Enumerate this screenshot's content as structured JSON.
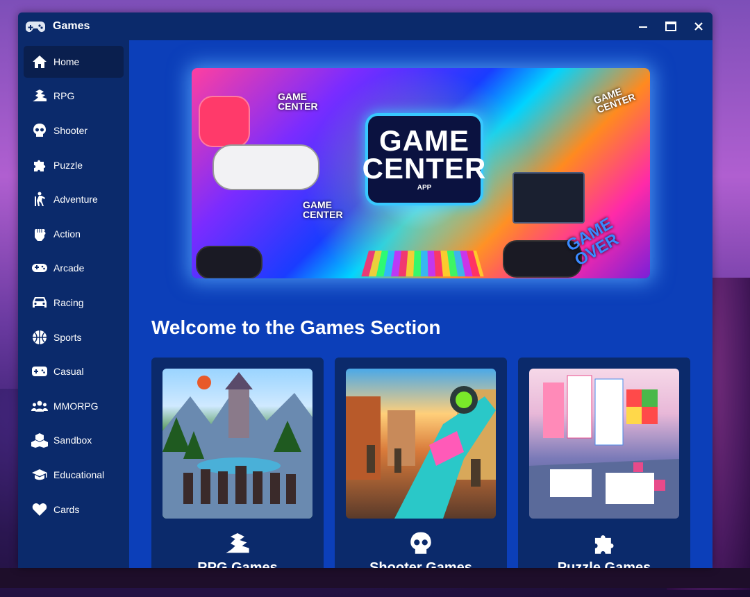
{
  "window": {
    "title": "Games"
  },
  "sidebar": {
    "items": [
      {
        "label": "Home",
        "icon": "home-icon",
        "active": true
      },
      {
        "label": "RPG",
        "icon": "dragon-icon"
      },
      {
        "label": "Shooter",
        "icon": "skull-icon"
      },
      {
        "label": "Puzzle",
        "icon": "puzzle-piece-icon"
      },
      {
        "label": "Adventure",
        "icon": "hiker-icon"
      },
      {
        "label": "Action",
        "icon": "fist-icon"
      },
      {
        "label": "Arcade",
        "icon": "gamepad-icon"
      },
      {
        "label": "Racing",
        "icon": "car-icon"
      },
      {
        "label": "Sports",
        "icon": "basketball-icon"
      },
      {
        "label": "Casual",
        "icon": "controller-icon"
      },
      {
        "label": "MMORPG",
        "icon": "users-icon"
      },
      {
        "label": "Sandbox",
        "icon": "cubes-icon"
      },
      {
        "label": "Educational",
        "icon": "graduation-cap-icon"
      },
      {
        "label": "Cards",
        "icon": "heart-icon"
      }
    ]
  },
  "banner": {
    "headline": "GAME CENTER",
    "headline_line1": "GAME",
    "headline_line2": "CENTER",
    "subtitle": "APP",
    "side_label": "GAME CENTER",
    "side_label_line1": "GAME",
    "side_label_line2": "CENTER",
    "corner_text": "GAME OVER"
  },
  "main": {
    "welcome": "Welcome to the Games Section",
    "cards": [
      {
        "icon": "dragon-icon",
        "title": "RPG Games"
      },
      {
        "icon": "skull-icon",
        "title": "Shooter Games"
      },
      {
        "icon": "puzzle-piece-icon",
        "title": "Puzzle Games"
      }
    ]
  },
  "colors": {
    "window_bg": "#0c3fb9",
    "sidebar_bg": "#0b2a6b",
    "active_item_bg": "#0a1f4e",
    "text": "#ffffff"
  }
}
